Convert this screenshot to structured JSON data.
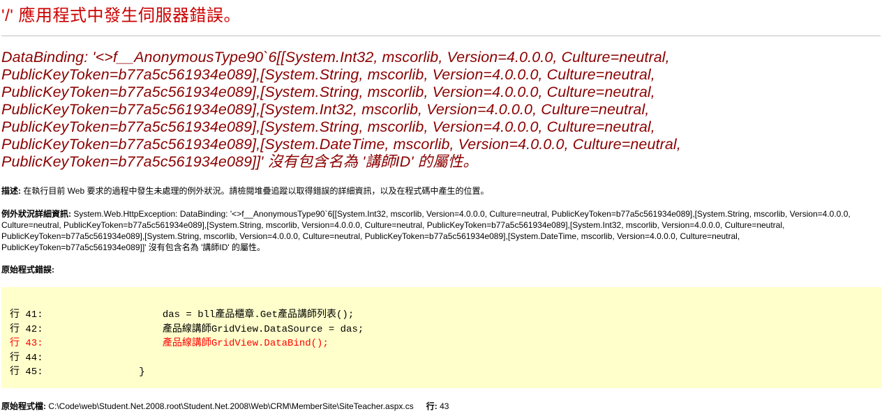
{
  "title": "'/' 應用程式中發生伺服器錯誤。",
  "error_message": "DataBinding: '<>f__AnonymousType90`6[[System.Int32, mscorlib, Version=4.0.0.0, Culture=neutral, PublicKeyToken=b77a5c561934e089],[System.String, mscorlib, Version=4.0.0.0, Culture=neutral, PublicKeyToken=b77a5c561934e089],[System.String, mscorlib, Version=4.0.0.0, Culture=neutral, PublicKeyToken=b77a5c561934e089],[System.Int32, mscorlib, Version=4.0.0.0, Culture=neutral, PublicKeyToken=b77a5c561934e089],[System.String, mscorlib, Version=4.0.0.0, Culture=neutral, PublicKeyToken=b77a5c561934e089],[System.DateTime, mscorlib, Version=4.0.0.0, Culture=neutral, PublicKeyToken=b77a5c561934e089]]' 沒有包含名為 '講師ID' 的屬性。",
  "description": {
    "label": "描述:",
    "text": " 在執行目前 Web 要求的過程中發生未處理的例外狀況。請檢閱堆疊追蹤以取得錯誤的詳細資訊，以及在程式碼中產生的位置。"
  },
  "exception_details": {
    "label": "例外狀況詳細資訊:",
    "text": " System.Web.HttpException: DataBinding: '<>f__AnonymousType90`6[[System.Int32, mscorlib, Version=4.0.0.0, Culture=neutral, PublicKeyToken=b77a5c561934e089],[System.String, mscorlib, Version=4.0.0.0, Culture=neutral, PublicKeyToken=b77a5c561934e089],[System.String, mscorlib, Version=4.0.0.0, Culture=neutral, PublicKeyToken=b77a5c561934e089],[System.Int32, mscorlib, Version=4.0.0.0, Culture=neutral, PublicKeyToken=b77a5c561934e089],[System.String, mscorlib, Version=4.0.0.0, Culture=neutral, PublicKeyToken=b77a5c561934e089],[System.DateTime, mscorlib, Version=4.0.0.0, Culture=neutral, PublicKeyToken=b77a5c561934e089]]' 沒有包含名為 '講師ID' 的屬性。"
  },
  "source_error_label": "原始程式錯誤:",
  "code_lines": [
    {
      "number": "行 41:",
      "code": "            das = bll產品櫃章.Get產品講師列表();",
      "error": false
    },
    {
      "number": "行 42:",
      "code": "            產品線講師GridView.DataSource = das;",
      "error": false
    },
    {
      "number": "行 43:",
      "code": "            產品線講師GridView.DataBind();",
      "error": true
    },
    {
      "number": "行 44:",
      "code": "",
      "error": false
    },
    {
      "number": "行 45:",
      "code": "        }",
      "error": false
    }
  ],
  "source_file": {
    "label": "原始程式檔:",
    "path": " C:\\Code\\web\\Student.Net.2008.root\\Student.Net.2008\\Web\\CRM\\MemberSite\\SiteTeacher.aspx.cs",
    "line_label": "行:",
    "line_value": " 43"
  },
  "colors": {
    "title": "#cc0000",
    "error_message": "#8b0000",
    "code_background": "#ffffcc",
    "error_line": "#ff0000"
  }
}
